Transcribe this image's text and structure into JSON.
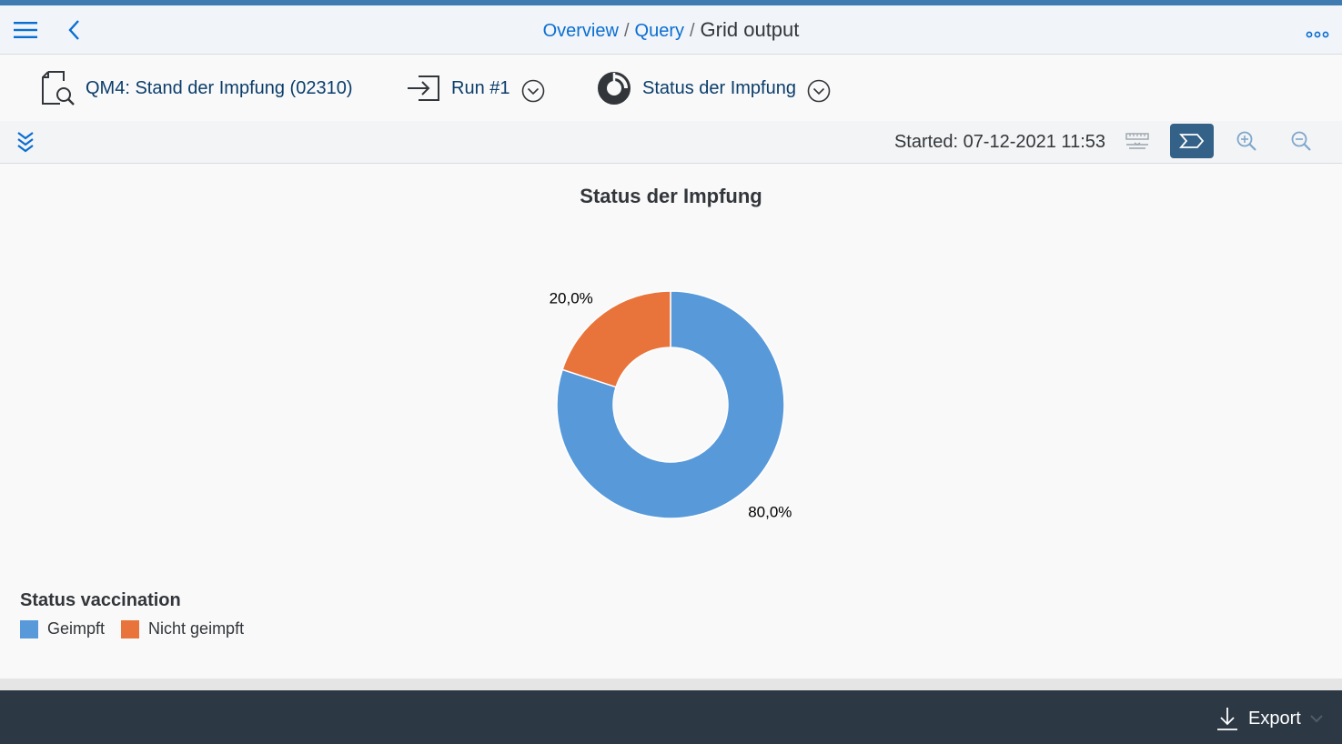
{
  "shell": {
    "breadcrumb": {
      "links": [
        "Overview",
        "Query"
      ],
      "separator": "/",
      "current": "Grid output"
    },
    "icons": {
      "menu": "hamburger-icon",
      "back": "chevron-left-icon",
      "more": "overflow-dots-icon"
    }
  },
  "header": {
    "query_label": "QM4: Stand der Impfung (02310)",
    "run_label": "Run #1",
    "viz_label": "Status der Impfung"
  },
  "toolbar": {
    "started": "Started: 07-12-2021 11:53"
  },
  "colors": {
    "accent": "#0a6ed1",
    "active_button": "#346187",
    "footer": "#2d3845",
    "geimpft": "#5899da",
    "nicht_geimpft": "#e8743b"
  },
  "chart_data": {
    "type": "pie",
    "donut": true,
    "title": "Status der Impfung",
    "slices": [
      {
        "label": "Geimpft",
        "value": 80.0,
        "display": "80,0%",
        "color": "#5899da"
      },
      {
        "label": "Nicht geimpft",
        "value": 20.0,
        "display": "20,0%",
        "color": "#e8743b"
      }
    ],
    "legend_title": "Status vaccination",
    "legend_position": "bottom-left"
  },
  "footer": {
    "export_label": "Export"
  }
}
